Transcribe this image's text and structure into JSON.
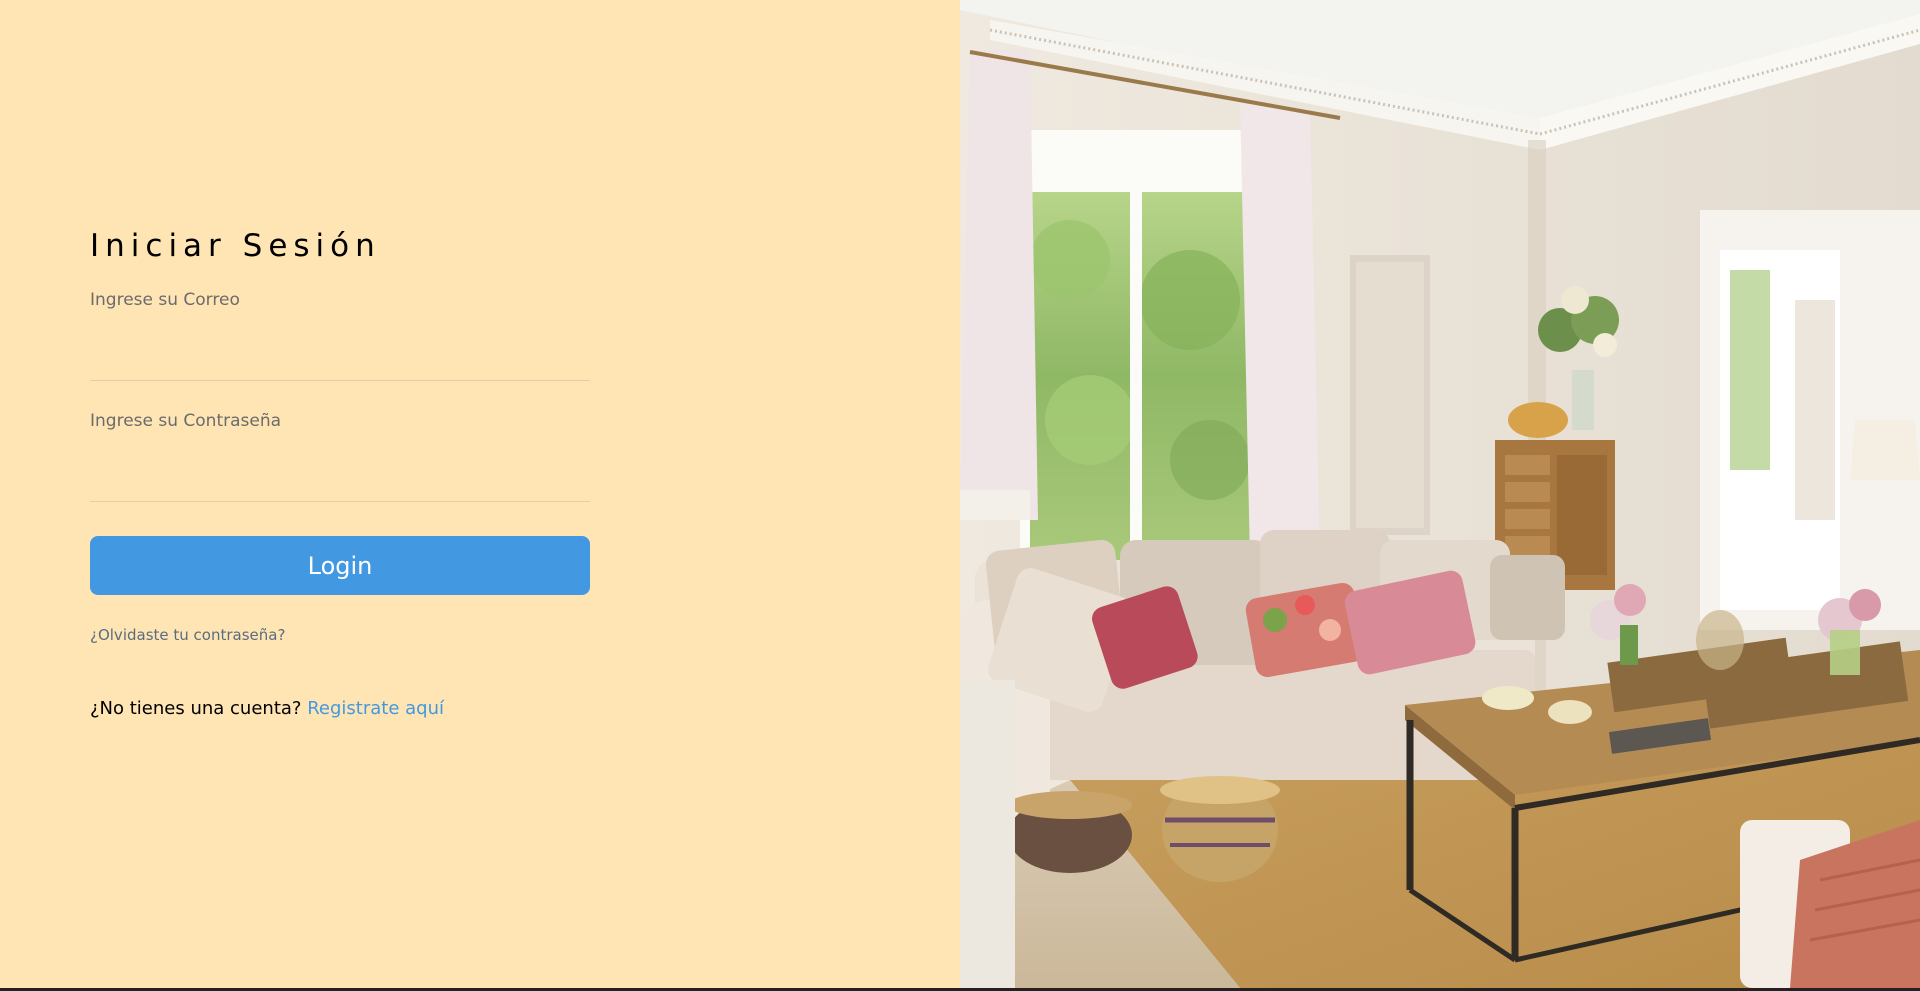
{
  "login": {
    "title": "Iniciar Sesión",
    "email_label": "Ingrese su Correo",
    "email_value": "",
    "password_label": "Ingrese su Contraseña",
    "password_value": "",
    "button_label": "Login",
    "forgot_link": "¿Olvidaste tu contraseña?",
    "signup_prompt": "¿No tienes una cuenta?",
    "signup_link": "Registrate aquí"
  },
  "colors": {
    "panel_background": "#ffe5b4",
    "accent": "#4299e1"
  }
}
